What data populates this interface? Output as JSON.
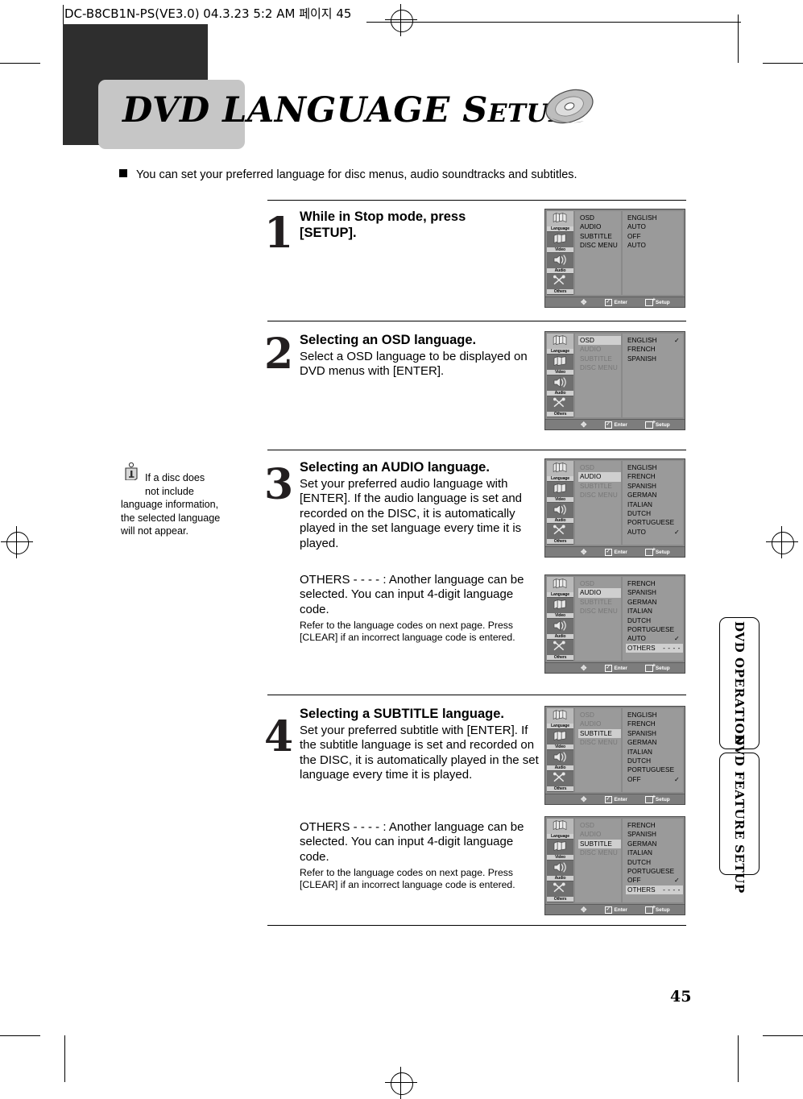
{
  "print_header": {
    "text": "DC-B8CB1N-PS(VE3.0)   04.3.23 5:2 AM   페이지 45"
  },
  "title": {
    "main": "DVD LANGUAGE S",
    "small_caps": "ETUP",
    "disc_icon": "dvd-disc-icon"
  },
  "intro": {
    "text": "You can set your preferred language for disc menus, audio soundtracks and subtitles."
  },
  "note": {
    "icon": "info-icon",
    "line1": "If a disc does",
    "line2": "not include",
    "line3": "language information,",
    "line4": "the selected language",
    "line5": "will not appear."
  },
  "steps": [
    {
      "num": "1",
      "heading": "While in Stop mode, press\n[SETUP].",
      "body": "",
      "sub": ""
    },
    {
      "num": "2",
      "heading": "Selecting an OSD language.",
      "body": "Select a OSD language to be displayed on DVD menus with [ENTER].",
      "sub": ""
    },
    {
      "num": "3",
      "heading": "Selecting an AUDIO language.",
      "body": "Set your preferred audio language with [ENTER]. If the audio language is set and recorded on the DISC, it is automatically played in the set language every time it is played.",
      "others_body": "OTHERS - - - - : Another language can be selected. You can input 4-digit language code.",
      "others_sub": "Refer to the language codes on next page. Press [CLEAR] if an incorrect language code is entered."
    },
    {
      "num": "4",
      "heading": "Selecting a SUBTITLE language.",
      "body": "Set your preferred subtitle with [ENTER]. If the subtitle language is set and recorded on the DISC, it is automatically played in the set language every time it is played.",
      "others_body": "OTHERS - - - - : Another language can be selected. You can input 4-digit language code.",
      "others_sub": "Refer to the language codes on next page. Press [CLEAR] if an incorrect language code is entered."
    }
  ],
  "osd_common": {
    "sidebar": [
      {
        "label": "Language",
        "icon": "books-icon"
      },
      {
        "label": "Video",
        "icon": "film-books-icon"
      },
      {
        "label": "Audio",
        "icon": "speaker-icon"
      },
      {
        "label": "Others",
        "icon": "tools-icon"
      }
    ],
    "statusbar": {
      "nav": "dpad-icon",
      "enter_icon": "checkbox-icon",
      "enter": "Enter",
      "setup_icon": "setup-icon",
      "setup": "Setup"
    },
    "menu_items": [
      "OSD",
      "AUDIO",
      "SUBTITLE",
      "DISC MENU"
    ]
  },
  "osd_screens": [
    {
      "id": "osd-screen-1",
      "selected_sidebar": "Language",
      "menu": [
        {
          "label": "OSD",
          "state": "normal"
        },
        {
          "label": "AUDIO",
          "state": "normal"
        },
        {
          "label": "SUBTITLE",
          "state": "normal"
        },
        {
          "label": "DISC MENU",
          "state": "normal"
        }
      ],
      "values": [
        {
          "label": "ENGLISH",
          "state": "normal"
        },
        {
          "label": "AUTO",
          "state": "normal"
        },
        {
          "label": "OFF",
          "state": "normal"
        },
        {
          "label": "AUTO",
          "state": "normal"
        }
      ]
    },
    {
      "id": "osd-screen-2",
      "selected_sidebar": "Language",
      "menu": [
        {
          "label": "OSD",
          "state": "highlight"
        },
        {
          "label": "AUDIO",
          "state": "dim"
        },
        {
          "label": "SUBTITLE",
          "state": "dim"
        },
        {
          "label": "DISC MENU",
          "state": "dim"
        }
      ],
      "values": [
        {
          "label": "ENGLISH",
          "state": "normal",
          "check": true
        },
        {
          "label": "FRENCH",
          "state": "normal"
        },
        {
          "label": "SPANISH",
          "state": "normal"
        }
      ]
    },
    {
      "id": "osd-screen-3",
      "selected_sidebar": "Language",
      "menu": [
        {
          "label": "OSD",
          "state": "dim"
        },
        {
          "label": "AUDIO",
          "state": "highlight"
        },
        {
          "label": "SUBTITLE",
          "state": "dim"
        },
        {
          "label": "DISC MENU",
          "state": "dim"
        }
      ],
      "values": [
        {
          "label": "ENGLISH",
          "state": "normal"
        },
        {
          "label": "FRENCH",
          "state": "normal"
        },
        {
          "label": "SPANISH",
          "state": "normal"
        },
        {
          "label": "GERMAN",
          "state": "normal"
        },
        {
          "label": "ITALIAN",
          "state": "normal"
        },
        {
          "label": "DUTCH",
          "state": "normal"
        },
        {
          "label": "PORTUGUESE",
          "state": "normal"
        },
        {
          "label": "AUTO",
          "state": "normal",
          "check": true
        }
      ]
    },
    {
      "id": "osd-screen-4",
      "selected_sidebar": "Language",
      "menu": [
        {
          "label": "OSD",
          "state": "dim"
        },
        {
          "label": "AUDIO",
          "state": "highlight"
        },
        {
          "label": "SUBTITLE",
          "state": "dim"
        },
        {
          "label": "DISC MENU",
          "state": "dim"
        }
      ],
      "values": [
        {
          "label": "FRENCH",
          "state": "normal"
        },
        {
          "label": "SPANISH",
          "state": "normal"
        },
        {
          "label": "GERMAN",
          "state": "normal"
        },
        {
          "label": "ITALIAN",
          "state": "normal"
        },
        {
          "label": "DUTCH",
          "state": "normal"
        },
        {
          "label": "PORTUGUESE",
          "state": "normal"
        },
        {
          "label": "AUTO",
          "state": "normal",
          "check": true
        },
        {
          "label": "OTHERS",
          "state": "highlight",
          "dashes": "- - - -"
        }
      ]
    },
    {
      "id": "osd-screen-5",
      "selected_sidebar": "Language",
      "menu": [
        {
          "label": "OSD",
          "state": "dim"
        },
        {
          "label": "AUDIO",
          "state": "dim"
        },
        {
          "label": "SUBTITLE",
          "state": "highlight"
        },
        {
          "label": "DISC MENU",
          "state": "dim"
        }
      ],
      "values": [
        {
          "label": "ENGLISH",
          "state": "normal"
        },
        {
          "label": "FRENCH",
          "state": "normal"
        },
        {
          "label": "SPANISH",
          "state": "normal"
        },
        {
          "label": "GERMAN",
          "state": "normal"
        },
        {
          "label": "ITALIAN",
          "state": "normal"
        },
        {
          "label": "DUTCH",
          "state": "normal"
        },
        {
          "label": "PORTUGUESE",
          "state": "normal"
        },
        {
          "label": "OFF",
          "state": "normal",
          "check": true
        }
      ]
    },
    {
      "id": "osd-screen-6",
      "selected_sidebar": "Language",
      "menu": [
        {
          "label": "OSD",
          "state": "dim"
        },
        {
          "label": "AUDIO",
          "state": "dim"
        },
        {
          "label": "SUBTITLE",
          "state": "highlight"
        },
        {
          "label": "DISC MENU",
          "state": "dim"
        }
      ],
      "values": [
        {
          "label": "FRENCH",
          "state": "normal"
        },
        {
          "label": "SPANISH",
          "state": "normal"
        },
        {
          "label": "GERMAN",
          "state": "normal"
        },
        {
          "label": "ITALIAN",
          "state": "normal"
        },
        {
          "label": "DUTCH",
          "state": "normal"
        },
        {
          "label": "PORTUGUESE",
          "state": "normal"
        },
        {
          "label": "OFF",
          "state": "normal",
          "check": true
        },
        {
          "label": "OTHERS",
          "state": "highlight",
          "dashes": "- - - -"
        }
      ]
    }
  ],
  "side_tabs": [
    {
      "label": "DVD OPERATION"
    },
    {
      "label": "DVD FEATURE SETUP"
    }
  ],
  "page_number": "45"
}
